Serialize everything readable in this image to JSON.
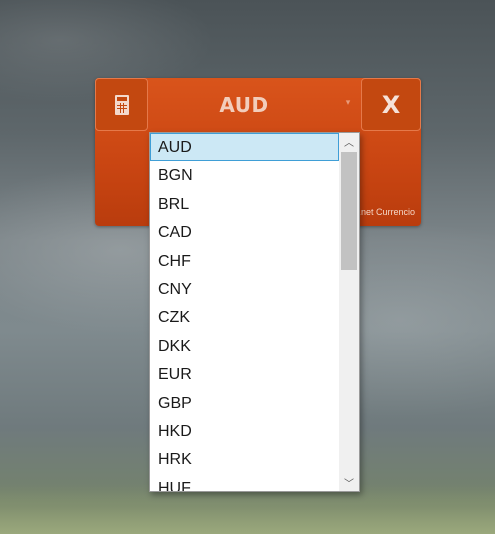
{
  "widget": {
    "selected_currency": "AUD",
    "close_label": "X",
    "footer_text": ".net Currencio"
  },
  "dropdown": {
    "selected": "AUD",
    "items": [
      "AUD",
      "BGN",
      "BRL",
      "CAD",
      "CHF",
      "CNY",
      "CZK",
      "DKK",
      "EUR",
      "GBP",
      "HKD",
      "HRK",
      "HUF"
    ]
  },
  "icons": {
    "calculator": "calculator-icon",
    "dropdown_arrow": "chevron-down-icon",
    "scroll_up": "chevron-up-icon",
    "scroll_down": "chevron-down-icon"
  },
  "colors": {
    "widget_accent": "#d9541b",
    "selection_bg": "#cce8f5",
    "selection_border": "#3f9ed6"
  }
}
